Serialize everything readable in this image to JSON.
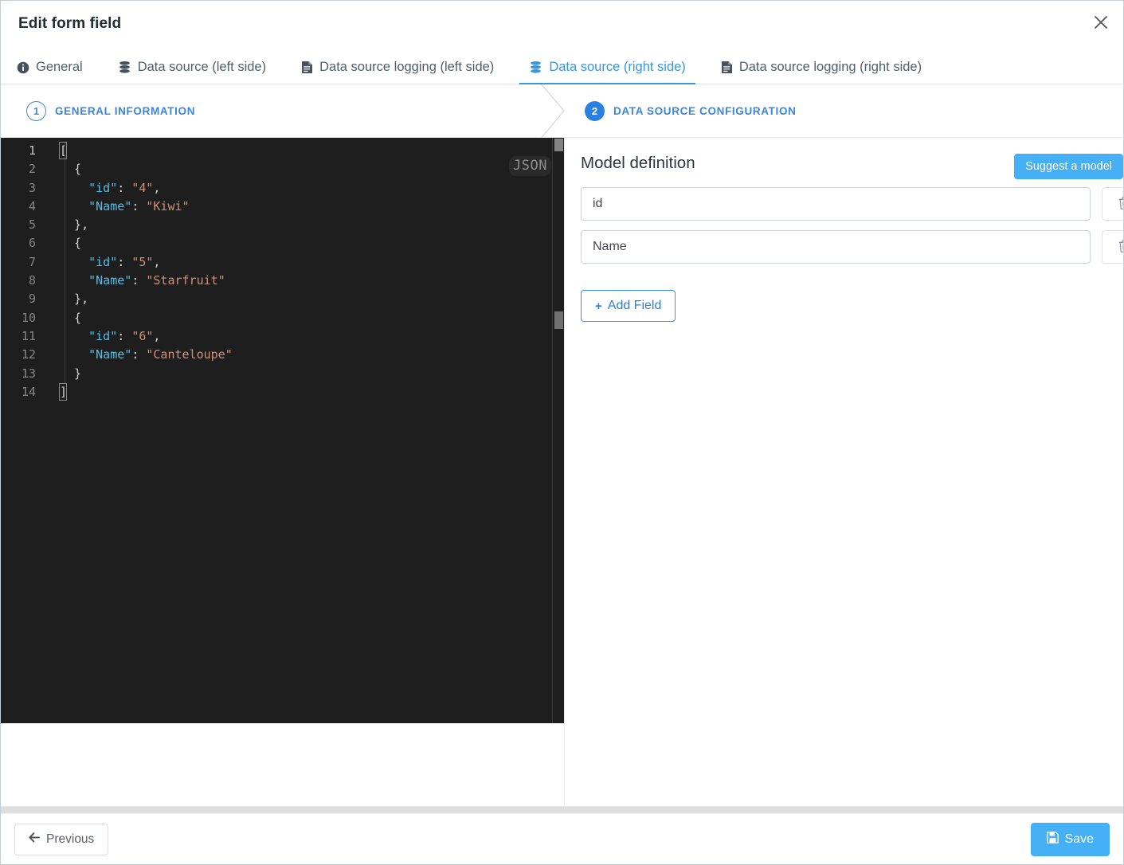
{
  "window": {
    "title": "Edit form field",
    "close_icon": "close-icon"
  },
  "tabs": [
    {
      "label": "General",
      "icon": "info-circle-icon",
      "active": false
    },
    {
      "label": "Data source (left side)",
      "icon": "database-icon",
      "active": false
    },
    {
      "label": "Data source logging (left side)",
      "icon": "file-lines-icon",
      "active": false
    },
    {
      "label": "Data source (right side)",
      "icon": "database-icon",
      "active": true
    },
    {
      "label": "Data source logging (right side)",
      "icon": "file-lines-icon",
      "active": false
    }
  ],
  "steps": [
    {
      "number": "1",
      "label": "GENERAL INFORMATION",
      "state": "outline"
    },
    {
      "number": "2",
      "label": "DATA SOURCE CONFIGURATION",
      "state": "filled"
    }
  ],
  "editor": {
    "language_badge": "JSON",
    "line_numbers": [
      "1",
      "2",
      "3",
      "4",
      "5",
      "6",
      "7",
      "8",
      "9",
      "10",
      "11",
      "12",
      "13",
      "14"
    ],
    "lines": [
      {
        "n": 1,
        "text": "["
      },
      {
        "n": 2,
        "text": "  {"
      },
      {
        "n": 3,
        "text": "    \"id\": \"4\","
      },
      {
        "n": 4,
        "text": "    \"Name\": \"Kiwi\""
      },
      {
        "n": 5,
        "text": "  },"
      },
      {
        "n": 6,
        "text": "  {"
      },
      {
        "n": 7,
        "text": "    \"id\": \"5\","
      },
      {
        "n": 8,
        "text": "    \"Name\": \"Starfruit\""
      },
      {
        "n": 9,
        "text": "  },"
      },
      {
        "n": 10,
        "text": "  {"
      },
      {
        "n": 11,
        "text": "    \"id\": \"6\","
      },
      {
        "n": 12,
        "text": "    \"Name\": \"Canteloupe\""
      },
      {
        "n": 13,
        "text": "  }"
      },
      {
        "n": 14,
        "text": "]"
      }
    ],
    "records": [
      {
        "id": "4",
        "Name": "Kiwi"
      },
      {
        "id": "5",
        "Name": "Starfruit"
      },
      {
        "id": "6",
        "Name": "Canteloupe"
      }
    ]
  },
  "model": {
    "heading": "Model definition",
    "suggest_label": "Suggest a model",
    "fields": [
      {
        "value": "id",
        "delete_icon": "trash-icon"
      },
      {
        "value": "Name",
        "delete_icon": "trash-icon"
      }
    ],
    "add_field_label": "Add Field",
    "add_field_plus": "+"
  },
  "footer": {
    "previous_label": "Previous",
    "save_label": "Save"
  },
  "colors": {
    "accent": "#45b0f5",
    "tab_active": "#3a96dd",
    "step_blue": "#3a86e0",
    "editor_bg": "#1e1e1e"
  }
}
